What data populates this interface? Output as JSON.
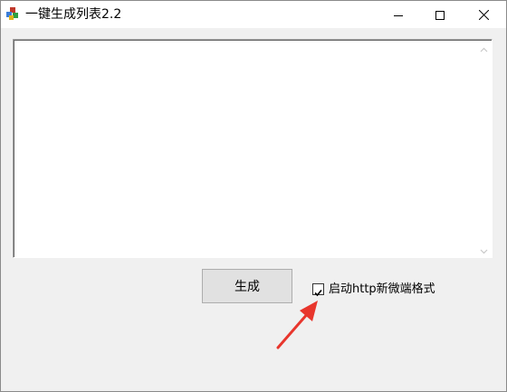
{
  "window": {
    "title": "一键生成列表2.2",
    "icon": "app-blocks-icon",
    "controls": {
      "minimize": "minimize-icon",
      "maximize": "maximize-icon",
      "close": "close-icon"
    }
  },
  "main": {
    "textbox": {
      "value": "",
      "scrollbar_icons": [
        "chevron-up-icon",
        "chevron-down-icon"
      ]
    },
    "generate_button": {
      "label": "生成"
    },
    "http_checkbox": {
      "label": "启动http新微端格式",
      "checked": true
    }
  },
  "annotation": {
    "icon": "red-arrow-icon",
    "color": "#e8362d"
  }
}
